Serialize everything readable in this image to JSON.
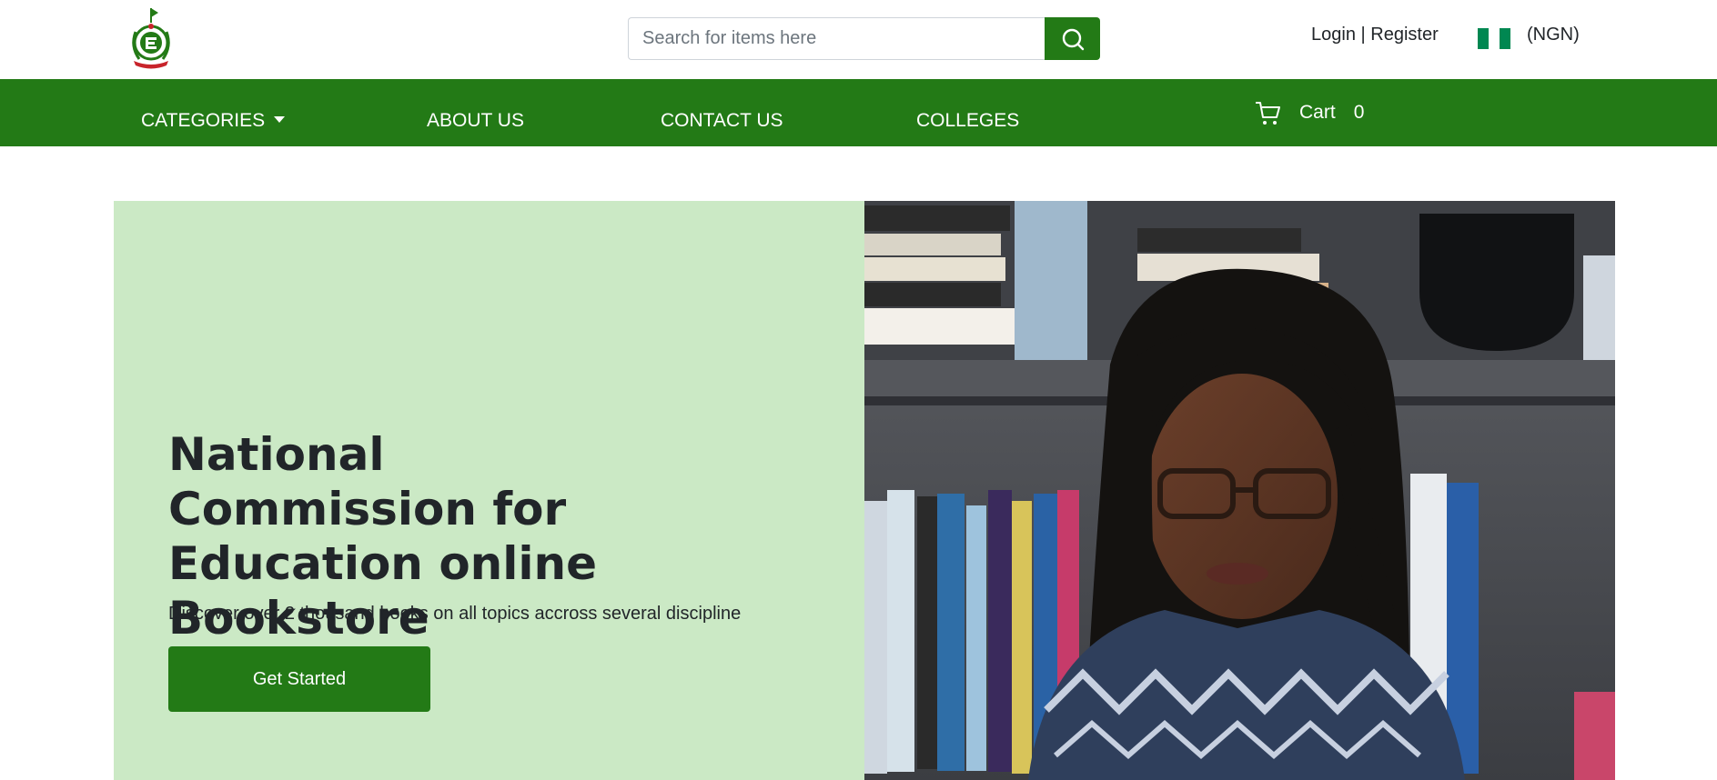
{
  "header": {
    "logo": {
      "icon": "nce-crest-logo",
      "colors": {
        "green": "#237a16",
        "red": "#c8242b"
      }
    },
    "search": {
      "placeholder": "Search for items here",
      "value": "",
      "button_icon": "search-icon"
    },
    "auth": {
      "login": "Login",
      "separator": " | ",
      "register": "Register"
    },
    "currency": {
      "flag_icon": "nigeria-flag-icon",
      "label": "(NGN)",
      "flag_colors": [
        "#008751",
        "#ffffff",
        "#008751"
      ]
    }
  },
  "nav": {
    "items": [
      {
        "label": "CATEGORIES",
        "has_dropdown": true
      },
      {
        "label": "ABOUT US"
      },
      {
        "label": "CONTACT US"
      },
      {
        "label": "COLLEGES"
      }
    ],
    "cart": {
      "icon": "cart-icon",
      "label": "Cart",
      "count": "0"
    }
  },
  "hero": {
    "title": "National Commission for Education online Bookstore",
    "subtitle": "Discover over 2 thousand books on all topics accross several discipline",
    "cta_label": "Get Started",
    "image": "student-reading-books-photo"
  },
  "theme": {
    "primary": "#237a16",
    "hero_bg": "#cbe9c5",
    "text": "#212529"
  }
}
